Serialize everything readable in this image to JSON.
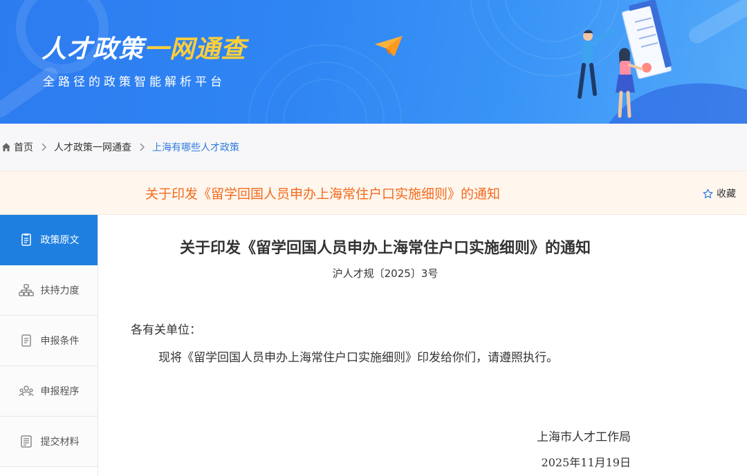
{
  "banner": {
    "title_main": "人才政策",
    "title_highlight": "一网通查",
    "subtitle": "全路径的政策智能解析平台",
    "accent_color": "#ffcf3a",
    "icons": [
      "paper-plane-icon"
    ]
  },
  "breadcrumb": {
    "items": [
      "首页",
      "人才政策一网通查",
      "上海有哪些人才政策"
    ]
  },
  "title_bar": {
    "title": "关于印发《留学回国人员申办上海常住户口实施细则》的通知",
    "favorite_label": "收藏",
    "title_color": "#f26b1d"
  },
  "sidebar": {
    "items": [
      {
        "label": "政策原文",
        "icon": "document-icon",
        "active": true
      },
      {
        "label": "扶持力度",
        "icon": "hierarchy-icon",
        "active": false
      },
      {
        "label": "申报条件",
        "icon": "checklist-icon",
        "active": false
      },
      {
        "label": "申报程序",
        "icon": "people-icon",
        "active": false
      },
      {
        "label": "提交材料",
        "icon": "materials-icon",
        "active": false
      }
    ],
    "active_color": "#1f7fe0"
  },
  "document": {
    "title": "关于印发《留学回国人员申办上海常住户口实施细则》的通知",
    "doc_number": "沪人才规〔2025〕3号",
    "salutation": "各有关单位：",
    "body": "现将《留学回国人员申办上海常住户口实施细则》印发给你们，请遵照执行。",
    "issuer": "上海市人才工作局",
    "date": "2025年11月19日"
  }
}
